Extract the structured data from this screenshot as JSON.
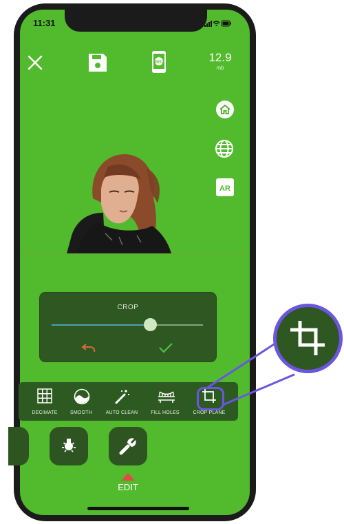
{
  "status": {
    "time": "11:31"
  },
  "top_bar": {
    "close_icon": "close-icon",
    "save_icon": "save-icon",
    "record_icon": "record-icon",
    "record_text": "REC",
    "file_size": "12.9",
    "file_size_unit": "mb"
  },
  "side_bar": {
    "ar_label": "AR"
  },
  "crop_panel": {
    "title": "CROP",
    "slider_value": 0.65
  },
  "toolbar": {
    "tools": [
      {
        "label": "DECIMATE"
      },
      {
        "label": "SMOOTH"
      },
      {
        "label": "AUTO CLEAN"
      },
      {
        "label": "FILL HOLES"
      },
      {
        "label": "CROP PLANE"
      }
    ]
  },
  "mode": {
    "active_label": "EDIT"
  },
  "colors": {
    "background": "#52ba2d",
    "panel": "#2f5721",
    "accent_highlight": "#6b56e0",
    "undo": "#d46b3c",
    "confirm": "#4cc24a"
  }
}
